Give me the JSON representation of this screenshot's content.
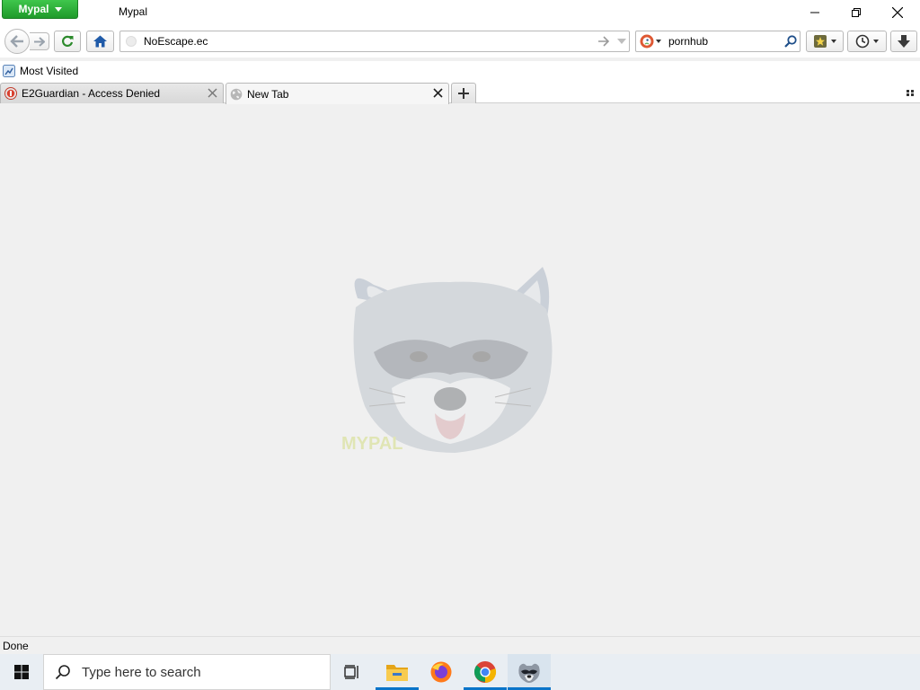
{
  "titlebar": {
    "app_menu_label": "Mypal",
    "window_title": "Mypal"
  },
  "navbar": {
    "url": "NoEscape.ec",
    "search_value": "pornhub"
  },
  "bookmarks_toolbar": {
    "items": [
      {
        "label": "Most Visited"
      }
    ]
  },
  "tabs": [
    {
      "label": "E2Guardian - Access Denied",
      "icon": "e2guardian-icon",
      "selected": false
    },
    {
      "label": "New Tab",
      "icon": "globe-icon",
      "selected": true
    }
  ],
  "content": {
    "logo_icon": "mypal-raccoon-logo",
    "logo_text": "MYPAL"
  },
  "statusbar": {
    "text": "Done"
  },
  "taskbar": {
    "search_placeholder": "Type here to search",
    "apps": [
      "task-view-icon",
      "file-explorer-icon",
      "firefox-icon",
      "chrome-icon",
      "mypal-icon"
    ]
  },
  "colors": {
    "app_menu_green": "#2fb13c",
    "content_bg": "#f0f0f0",
    "taskbar_bg": "#e9eef3",
    "taskbar_accent": "#0a74c9"
  }
}
